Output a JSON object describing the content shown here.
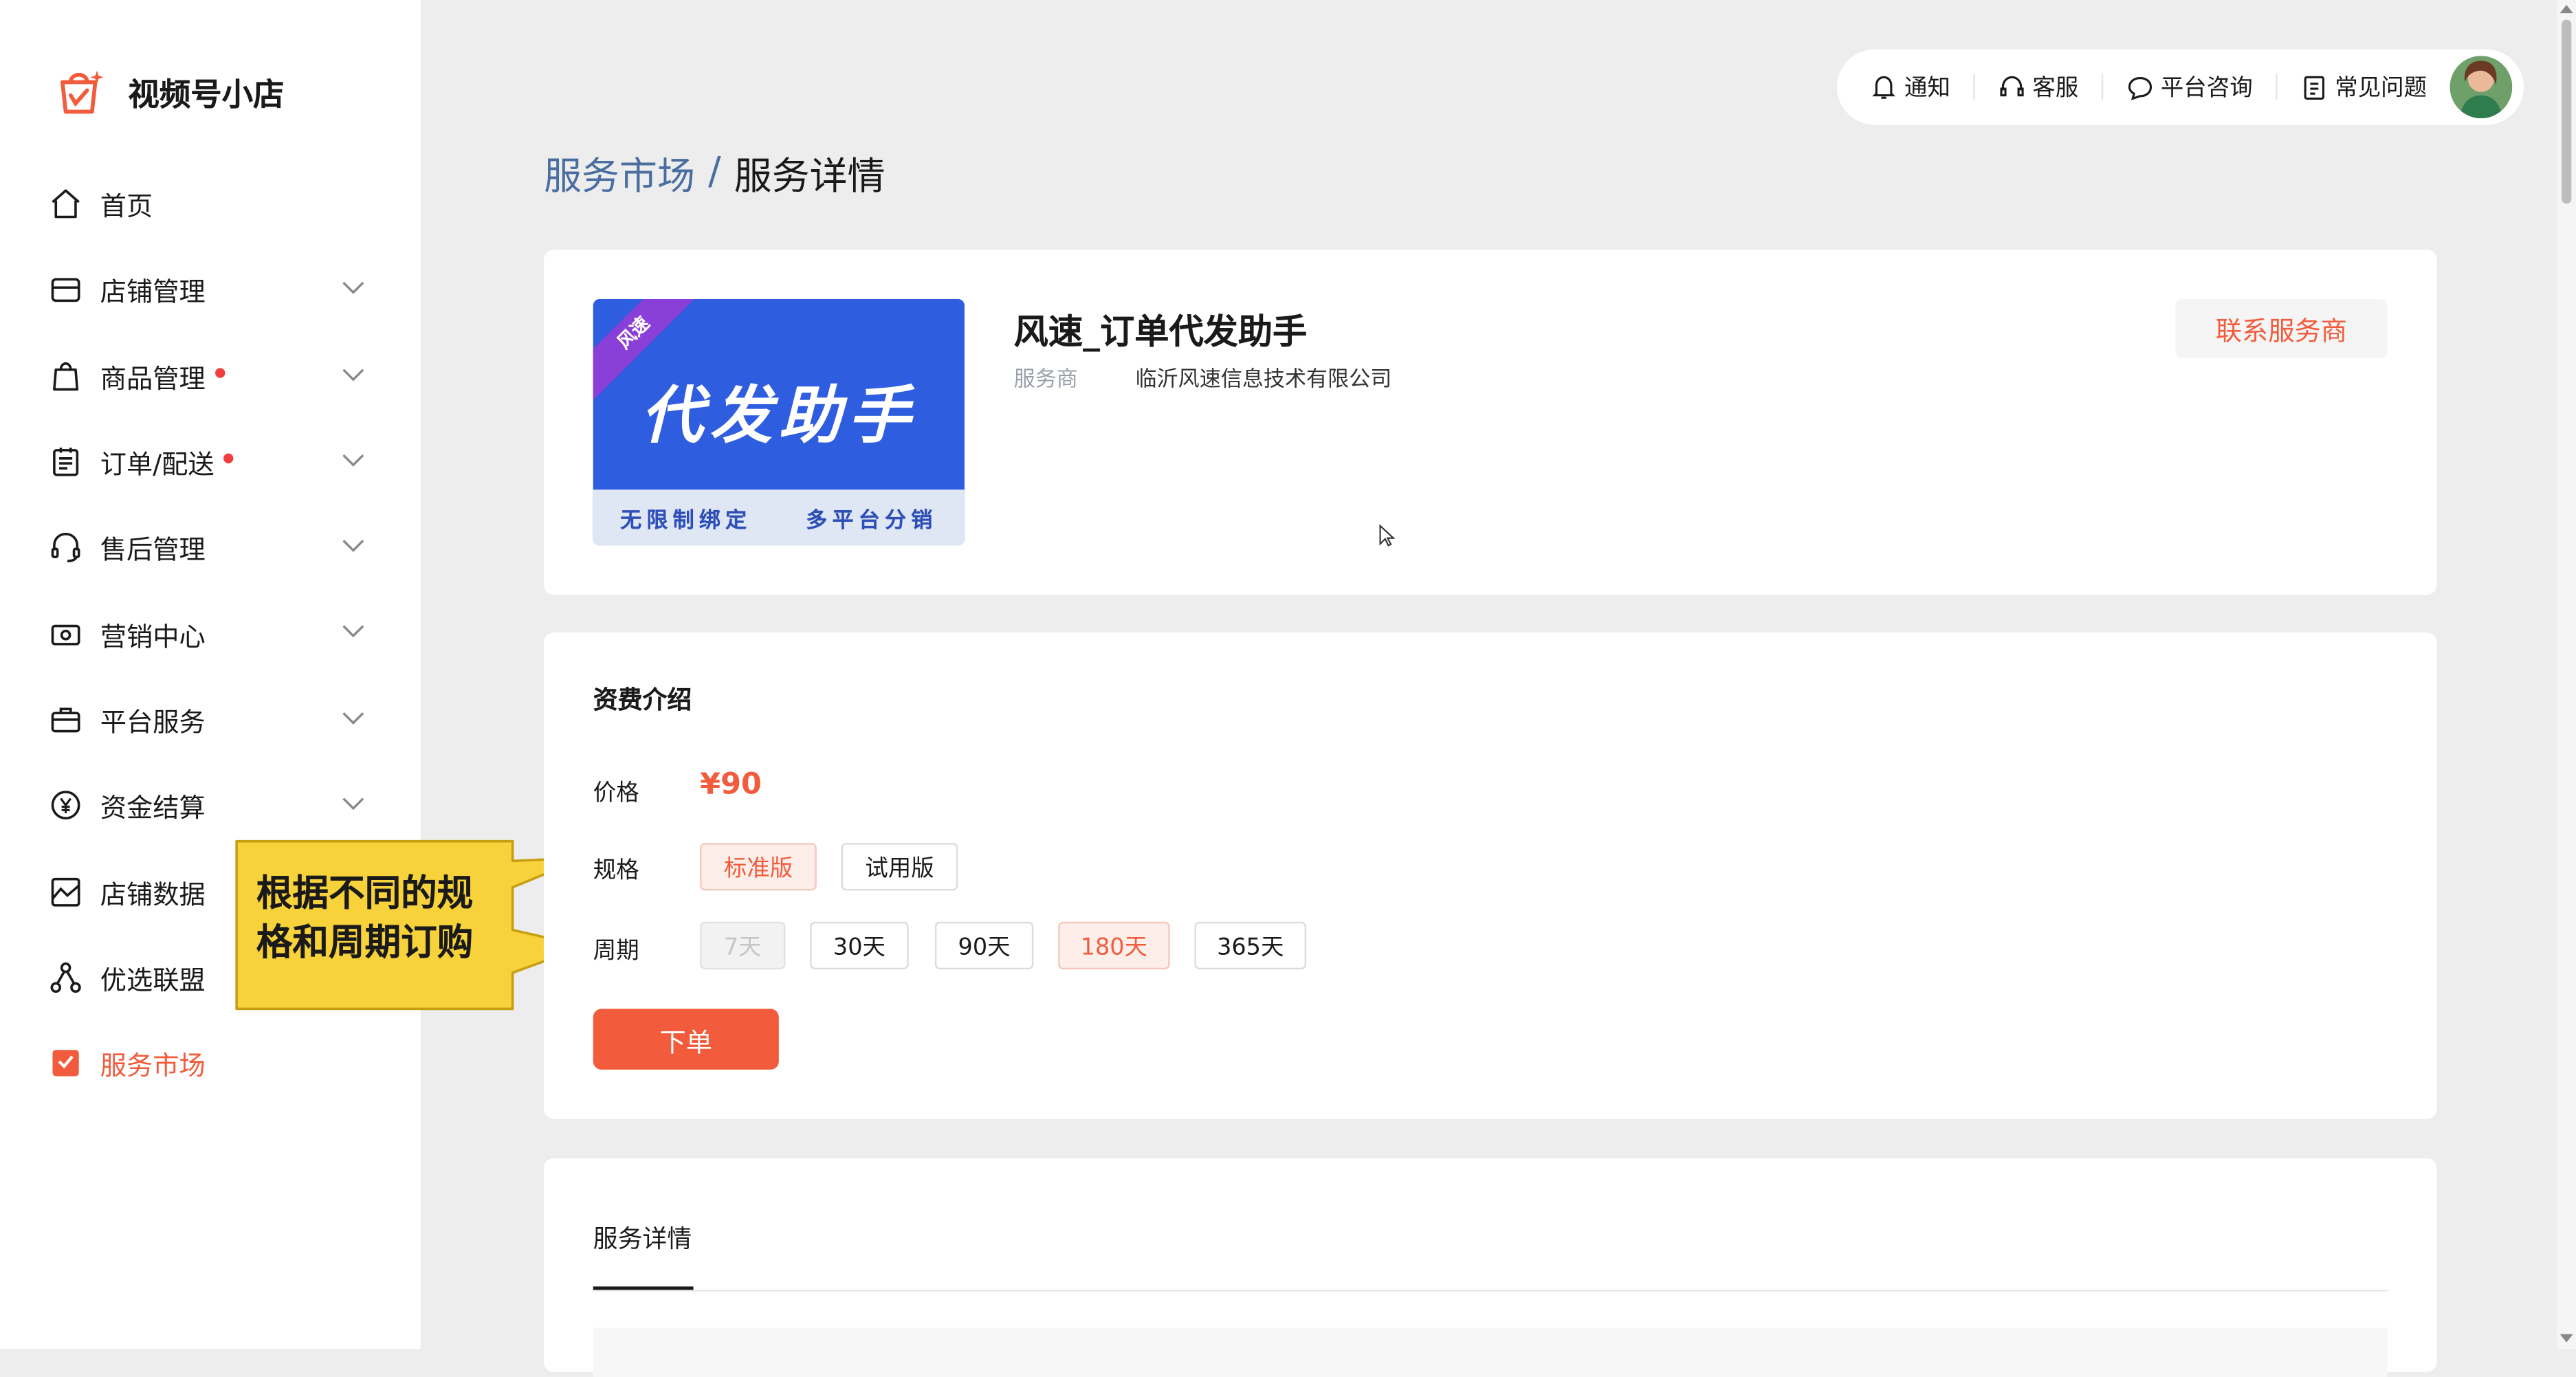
{
  "brand": {
    "name": "视频号小店"
  },
  "sidebar": {
    "items": [
      {
        "label": "首页",
        "icon": "home-icon"
      },
      {
        "label": "店铺管理",
        "icon": "store-icon"
      },
      {
        "label": "商品管理",
        "icon": "shopping-bag-icon"
      },
      {
        "label": "订单/配送",
        "icon": "order-list-icon"
      },
      {
        "label": "售后管理",
        "icon": "headset-icon"
      },
      {
        "label": "营销中心",
        "icon": "ticket-icon"
      },
      {
        "label": "平台服务",
        "icon": "briefcase-icon"
      },
      {
        "label": "资金结算",
        "icon": "yuan-icon"
      },
      {
        "label": "店铺数据",
        "icon": "chart-image-icon"
      },
      {
        "label": "优选联盟",
        "icon": "network-icon"
      },
      {
        "label": "服务市场",
        "icon": "puzzle-icon"
      }
    ]
  },
  "topbar": {
    "notify": "通知",
    "service": "客服",
    "consult": "平台咨询",
    "faq": "常见问题"
  },
  "breadcrumb": {
    "parent": "服务市场",
    "sep": "/",
    "current": "服务详情"
  },
  "service": {
    "title": "风速_订单代发助手",
    "provider_label": "服务商",
    "provider": "临沂风速信息技术有限公司",
    "contact": "联系服务商",
    "banner": {
      "title": "代发助手",
      "ribbon": "风速",
      "sub_left": "无限制绑定",
      "sub_right": "多平台分销"
    }
  },
  "pricing": {
    "section_title": "资费介绍",
    "price_label": "价格",
    "price": "¥90",
    "spec_label": "规格",
    "specs": [
      "标准版",
      "试用版"
    ],
    "period_label": "周期",
    "periods": [
      "7天",
      "30天",
      "90天",
      "180天",
      "365天"
    ],
    "order": "下单"
  },
  "details": {
    "tab": "服务详情"
  },
  "callout": {
    "text": "根据不同的规格和周期订购"
  },
  "colors": {
    "accent": "#f25c3d",
    "link": "#4a6ea0",
    "callout": "#f7d23a"
  }
}
